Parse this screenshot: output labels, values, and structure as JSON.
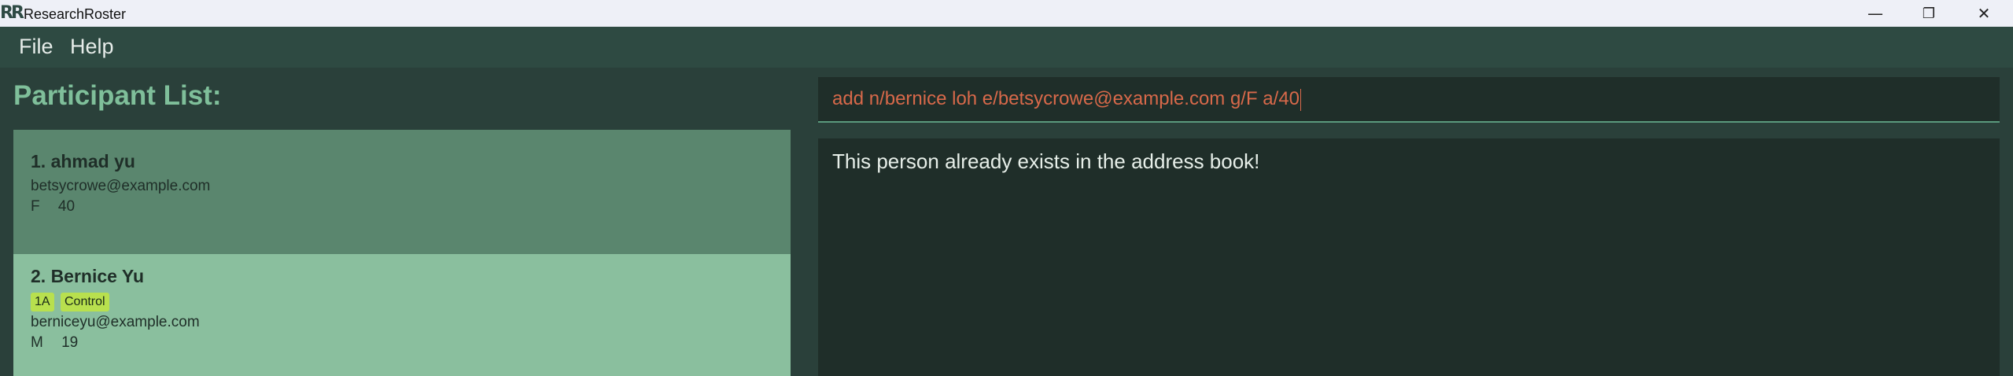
{
  "window": {
    "title": "ResearchRoster",
    "logo": "RR",
    "controls": {
      "minimize": "—",
      "restore": "❐",
      "close": "✕"
    }
  },
  "menu": {
    "items": [
      {
        "label": "File"
      },
      {
        "label": "Help"
      }
    ]
  },
  "participants": {
    "heading": "Participant List:",
    "items": [
      {
        "name": "1. ahmad yu",
        "tags": [],
        "email": "betsycrowe@example.com",
        "gender": "F",
        "age": "40"
      },
      {
        "name": "2. Bernice Yu",
        "tags": [
          "1A",
          "Control"
        ],
        "email": "berniceyu@example.com",
        "gender": "M",
        "age": "19"
      }
    ]
  },
  "command": {
    "value": "add n/bernice loh e/betsycrowe@example.com g/F a/40"
  },
  "result": {
    "message": "This person already exists in the address book!"
  },
  "colors": {
    "background": "#2a403a",
    "menubar": "#2e4a42",
    "selected_card": "#5a866e",
    "card": "#8abf9e",
    "tag": "#b8e04e",
    "heading": "#7fbf9a",
    "command_text_error": "#d8694a",
    "panel": "#1f2e29"
  }
}
